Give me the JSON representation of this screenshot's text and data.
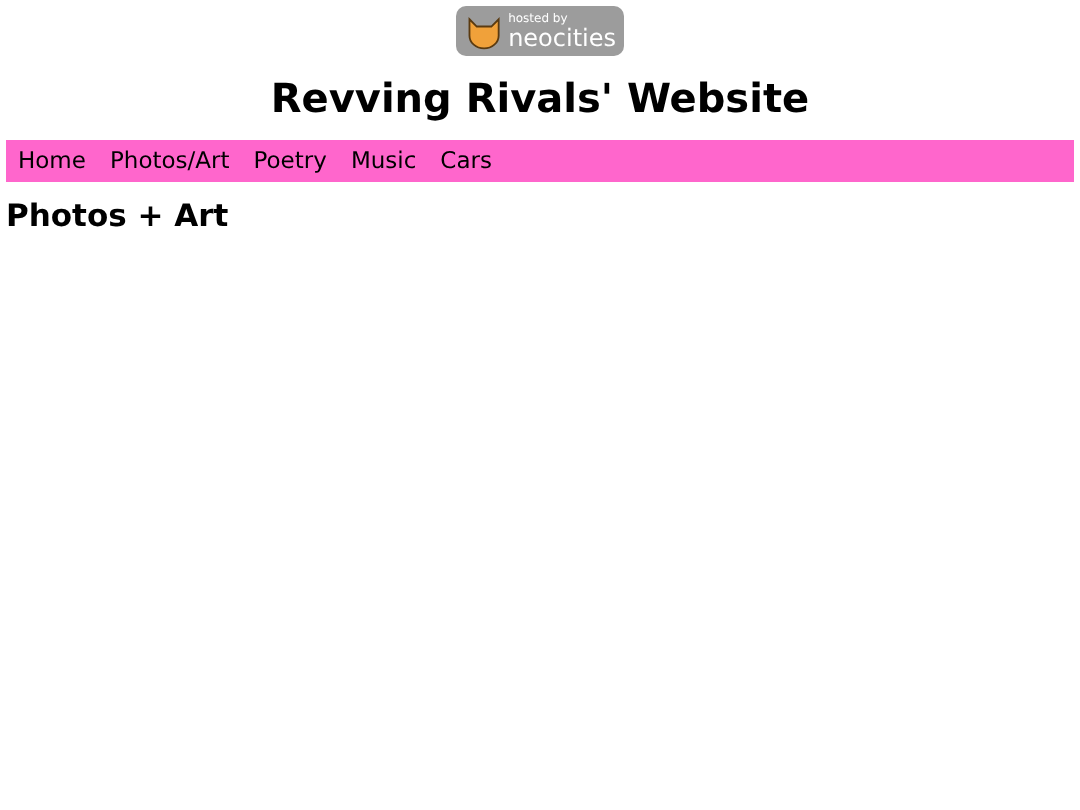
{
  "badge": {
    "line_1": "hosted by",
    "line_2": "neocities"
  },
  "title": "Revving Rivals' Website",
  "nav": [
    {
      "label": "Home"
    },
    {
      "label": "Photos/Art"
    },
    {
      "label": "Poetry"
    },
    {
      "label": "Music"
    },
    {
      "label": "Cars"
    }
  ],
  "heading": "Photos + Art"
}
